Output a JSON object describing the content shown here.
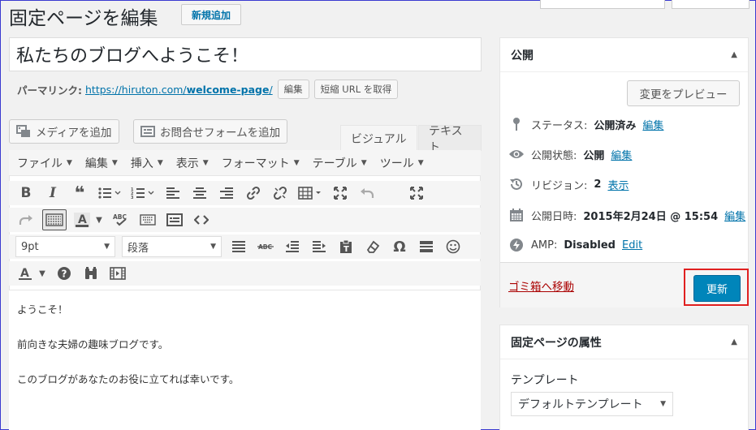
{
  "header": {
    "title": "固定ページを編集",
    "add_new": "新規追加"
  },
  "post": {
    "title": "私たちのブログへようこそ！",
    "permalink_label": "パーマリンク:",
    "permalink_base": "https://hiruton.com/",
    "permalink_slug": "welcome-page",
    "permalink_trailing": "/",
    "edit_label": "編集",
    "shortlink_label": "短縮 URL を取得"
  },
  "media": {
    "add_media": "メディアを追加",
    "add_form": "お問合せフォームを追加"
  },
  "tabs": {
    "visual": "ビジュアル",
    "text": "テキスト"
  },
  "menubar": [
    "ファイル",
    "編集",
    "挿入",
    "表示",
    "フォーマット",
    "テーブル",
    "ツール"
  ],
  "format": {
    "font_size": "9pt",
    "paragraph": "段落"
  },
  "content": {
    "lines": [
      "ようこそ！",
      "前向きな夫婦の趣味ブログです。",
      "このブログがあなたのお役に立てれば幸いです。"
    ]
  },
  "publish": {
    "title": "公開",
    "preview": "変更をプレビュー",
    "status_label": "ステータス:",
    "status_value": "公開済み",
    "visibility_label": "公開状態:",
    "visibility_value": "公開",
    "revisions_label": "リビジョン:",
    "revisions_value": "2",
    "revisions_link": "表示",
    "date_label": "公開日時:",
    "date_value": "2015年2月24日 @ 15:54",
    "amp_label": "AMP:",
    "amp_value": "Disabled",
    "amp_link": "Edit",
    "edit_link": "編集",
    "trash": "ゴミ箱へ移動",
    "update": "更新"
  },
  "attributes": {
    "title": "固定ページの属性",
    "template_label": "テンプレート",
    "template_value": "デフォルトテンプレート"
  }
}
